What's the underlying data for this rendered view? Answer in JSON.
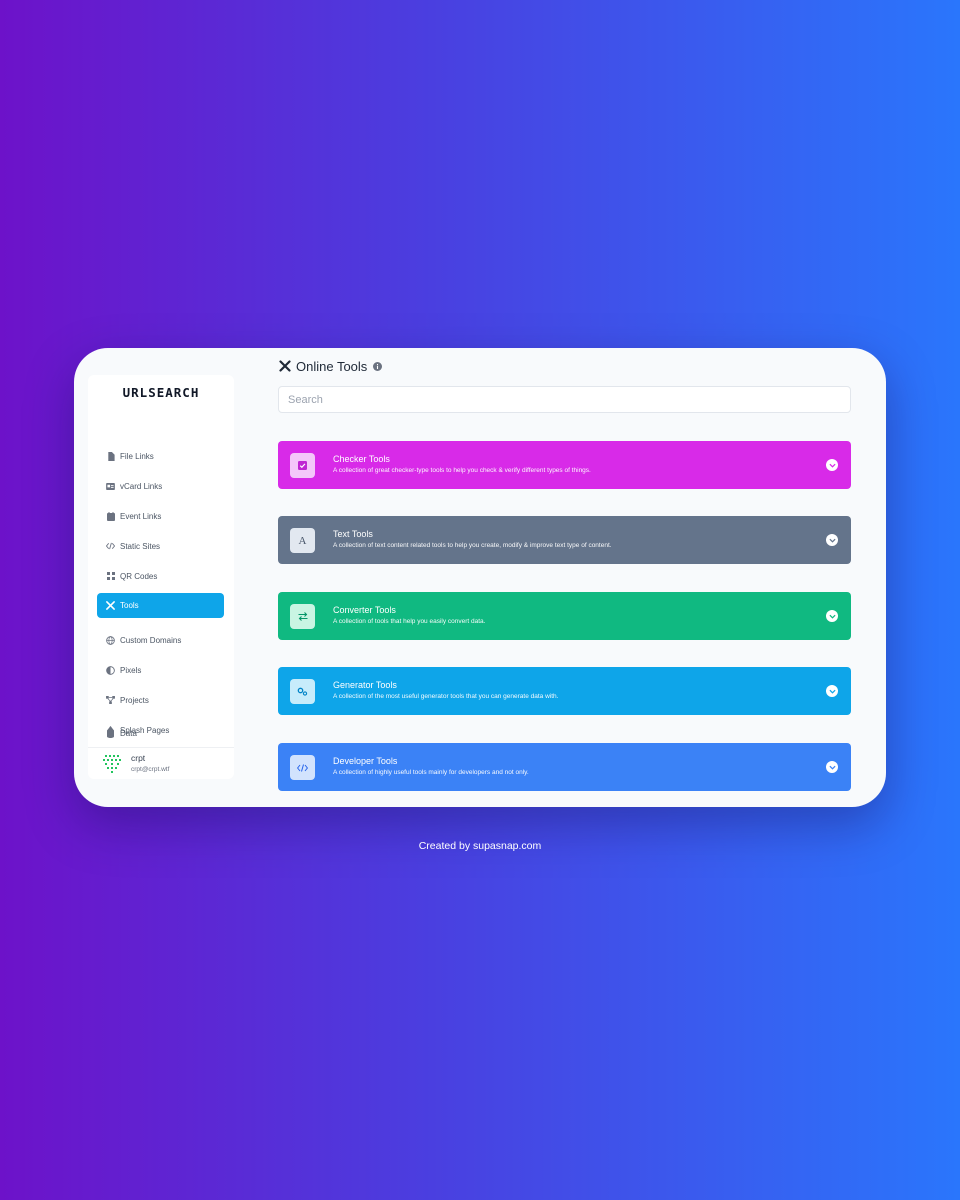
{
  "app": {
    "brand": "URLSEARCH"
  },
  "sidebar": {
    "items": [
      {
        "label": "File Links",
        "icon": "file-icon"
      },
      {
        "label": "vCard Links",
        "icon": "id-card-icon"
      },
      {
        "label": "Event Links",
        "icon": "calendar-icon"
      },
      {
        "label": "Static Sites",
        "icon": "code-icon"
      },
      {
        "label": "QR Codes",
        "icon": "qr-code-icon"
      },
      {
        "label": "Tools",
        "icon": "tools-icon",
        "active": true
      },
      {
        "label": "Custom Domains",
        "icon": "globe-icon"
      },
      {
        "label": "Pixels",
        "icon": "half-circle-icon"
      },
      {
        "label": "Projects",
        "icon": "project-diagram-icon"
      },
      {
        "label": "Splash Pages",
        "icon": "droplet-icon"
      },
      {
        "label": "Data",
        "icon": "database-icon"
      }
    ],
    "user": {
      "name": "crpt",
      "email": "crpt@crpt.wtf"
    }
  },
  "main": {
    "title": "Online Tools",
    "search_placeholder": "Search",
    "search_value": "",
    "categories": [
      {
        "title": "Checker Tools",
        "description": "A collection of great checker-type tools to help you check & verify different types of things.",
        "color": "#d82ae8",
        "icon": "check-square-icon",
        "icon_bg": "#f4c6fa",
        "icon_fg": "#c026d3"
      },
      {
        "title": "Text Tools",
        "description": "A collection of text content related tools to help you create, modify & improve text type of content.",
        "color": "#64748b",
        "icon": "letter-a-icon",
        "icon_bg": "#e2e8f0",
        "icon_fg": "#475569"
      },
      {
        "title": "Converter Tools",
        "description": "A collection of tools that help you easily convert data.",
        "color": "#10b981",
        "icon": "exchange-icon",
        "icon_bg": "#c9f5e3",
        "icon_fg": "#059669"
      },
      {
        "title": "Generator Tools",
        "description": "A collection of the most useful generator tools that you can generate data with.",
        "color": "#0ea5e9",
        "icon": "cogs-icon",
        "icon_bg": "#c7ecfb",
        "icon_fg": "#0284c7"
      },
      {
        "title": "Developer Tools",
        "description": "A collection of highly useful tools mainly for developers and not only.",
        "color": "#3b82f6",
        "icon": "code-icon",
        "icon_bg": "#d2e3fd",
        "icon_fg": "#2563eb"
      }
    ]
  },
  "footer": {
    "credit": "Created by supasnap.com"
  }
}
